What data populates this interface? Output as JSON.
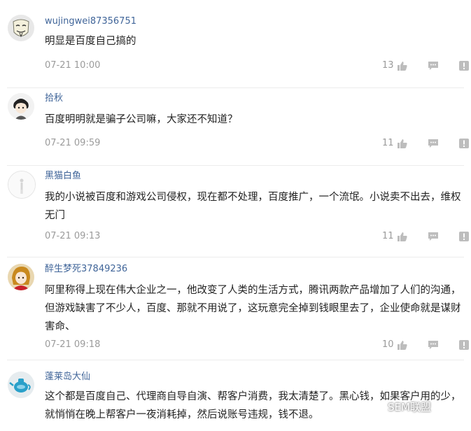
{
  "comments": [
    {
      "username": "wujingwei87356751",
      "text": "明显是百度自己搞的",
      "time": "07-21 10:00",
      "likes": "13",
      "avatar_icon": "mask-avatar-icon"
    },
    {
      "username": "拾秋",
      "text": "百度明明就是骗子公司嘛，大家还不知道？",
      "time": "07-21 09:59",
      "likes": "11",
      "avatar_icon": "cartoon-avatar-icon"
    },
    {
      "username": "黑猫白鱼",
      "text": "我的小说被百度和游戏公司侵权，现在都不处理，百度推广，一个流氓。小说卖不出去，维权无门",
      "time": "07-21 09:13",
      "likes": "11",
      "avatar_icon": "figure-avatar-icon"
    },
    {
      "username": "醉生梦死37849236",
      "text": "阿里称得上现在伟大企业之一，他改变了人类的生活方式，腾讯两款产品增加了人们的沟通，但游戏缺害了不少人，百度、那就不用说了，这玩意完全掉到钱眼里去了，企业使命就是谋财害命、",
      "time": "07-21 09:18",
      "likes": "10",
      "avatar_icon": "anime-avatar-icon"
    },
    {
      "username": "蓬莱岛大仙",
      "text": "这个都是百度自己、代理商自导自演、帮客户消费，我太清楚了。黑心钱，如果客户用的少，就悄悄在晚上帮客户一夜消耗掉，然后说账号违规，钱不退。",
      "time": "",
      "likes": "",
      "avatar_icon": "teapot-avatar-icon"
    }
  ],
  "watermark": {
    "text": "SEM联盟",
    "icon": "wechat-logo-icon"
  },
  "colors": {
    "username": "#406599",
    "meta": "#9b9b9b",
    "text": "#222222",
    "icon": "#bdbdbd"
  }
}
